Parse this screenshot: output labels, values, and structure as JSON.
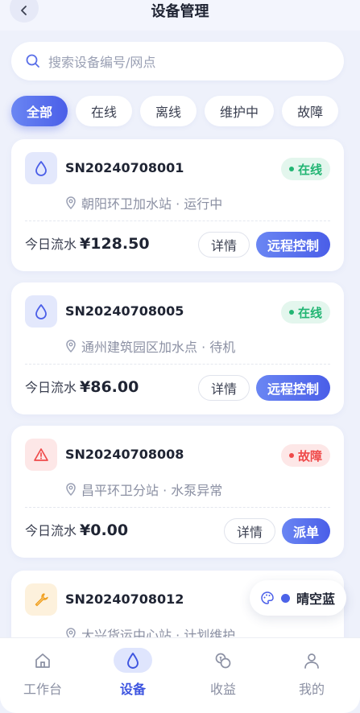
{
  "header": {
    "title": "设备管理"
  },
  "search": {
    "placeholder": "搜索设备编号/网点"
  },
  "filters": [
    {
      "label": "全部",
      "active": true
    },
    {
      "label": "在线"
    },
    {
      "label": "离线"
    },
    {
      "label": "维护中"
    },
    {
      "label": "故障"
    }
  ],
  "devices": [
    {
      "id": "SN20240708001",
      "icon": "water-drop-icon",
      "status": "在线",
      "location": "朝阳环卫加水站 · 运行中",
      "revenue_label": "今日流水",
      "revenue": "¥128.50",
      "detail_label": "详情",
      "action_label": "远程控制"
    },
    {
      "id": "SN20240708005",
      "icon": "water-drop-icon",
      "status": "在线",
      "location": "通州建筑园区加水点 · 待机",
      "revenue_label": "今日流水",
      "revenue": "¥86.00",
      "detail_label": "详情",
      "action_label": "远程控制"
    },
    {
      "id": "SN20240708008",
      "icon": "warning-triangle-icon",
      "status": "故障",
      "location": "昌平环卫分站 · 水泵异常",
      "revenue_label": "今日流水",
      "revenue": "¥0.00",
      "detail_label": "详情",
      "action_label": "派单"
    },
    {
      "id": "SN20240708012",
      "icon": "wrench-icon",
      "location": "大兴货运中心站 · 计划维护"
    }
  ],
  "theme": {
    "label": "晴空蓝",
    "icon": "palette-icon"
  },
  "tabbar": [
    {
      "label": "工作台",
      "icon": "home-icon"
    },
    {
      "label": "设备",
      "icon": "water-drop-icon",
      "active": true
    },
    {
      "label": "收益",
      "icon": "coins-icon"
    },
    {
      "label": "我的",
      "icon": "user-icon"
    }
  ],
  "colors": {
    "accent": "#4a5ee8",
    "online": "#22b573",
    "online_bg": "#e3f6ed",
    "fault": "#ef4a4a",
    "fault_bg": "#fde7e7",
    "maintenance": "#f0a020",
    "maintenance_bg": "#fdf1dc"
  }
}
